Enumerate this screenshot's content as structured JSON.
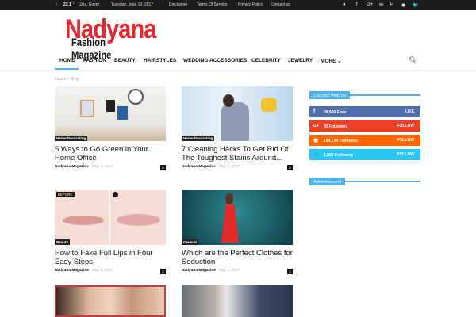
{
  "topbar": {
    "weather": "23.1",
    "unit": "C",
    "location": "Giza, Egypt",
    "date": "Tuesday, June 13, 2017",
    "links": [
      "Disclaimer",
      "Terms Of Service",
      "Privacy Policy",
      "Contact us"
    ]
  },
  "logo": {
    "line1": "Nadyana",
    "line2": "Fashion Magazine"
  },
  "nav": {
    "items": [
      "HOME",
      "FASHION",
      "BEAUTY",
      "HAIRSTYLES",
      "WEDDING ACCESSORIES",
      "CELEBRITY",
      "JEWELRY",
      "MORE ⌄"
    ]
  },
  "breadcrumb": {
    "home": "Home",
    "sep": "›",
    "current": "Blog"
  },
  "posts": [
    {
      "category": "Home Decorating",
      "title": "5 Ways to Go Green in Your Home Office",
      "author": "Nadyana Magazine",
      "date": "May 4, 2017",
      "comments": "0"
    },
    {
      "category": "Home Decorating",
      "title": "7 Cleaning Hacks To Get Rid Of The Toughest Stains Around...",
      "author": "Nadyana Magazine",
      "date": "May 1, 2017",
      "comments": "0"
    },
    {
      "category": "Beauty",
      "badge": "BEFORE",
      "title": "How to Fake Full Lips in Four Easy Steps",
      "author": "Nadyana Magazine",
      "date": "May 1, 2017",
      "comments": "0"
    },
    {
      "category": "General",
      "title": "Which are the Perfect Clothes for Seduction",
      "author": "Nadyana Magazine",
      "date": "May 1, 2017",
      "comments": "0"
    }
  ],
  "sidebar": {
    "connect_title": "Connect With Us",
    "social": [
      {
        "icon": "f",
        "count": "58,930",
        "label": "Fans",
        "action": "LIKE",
        "color": "#516eab"
      },
      {
        "icon": "G+",
        "count": "92",
        "label": "Followers",
        "action": "FOLLOW",
        "color": "#eb4026"
      },
      {
        "icon": "◉",
        "count": "184,734",
        "label": "Followers",
        "action": "FOLLOW",
        "color": "#ff6600"
      },
      {
        "icon": "🐦",
        "count": "1,893",
        "label": "Followers",
        "action": "FOLLOW",
        "color": "#29c5f6"
      }
    ],
    "ad_title": "Advertisement"
  }
}
